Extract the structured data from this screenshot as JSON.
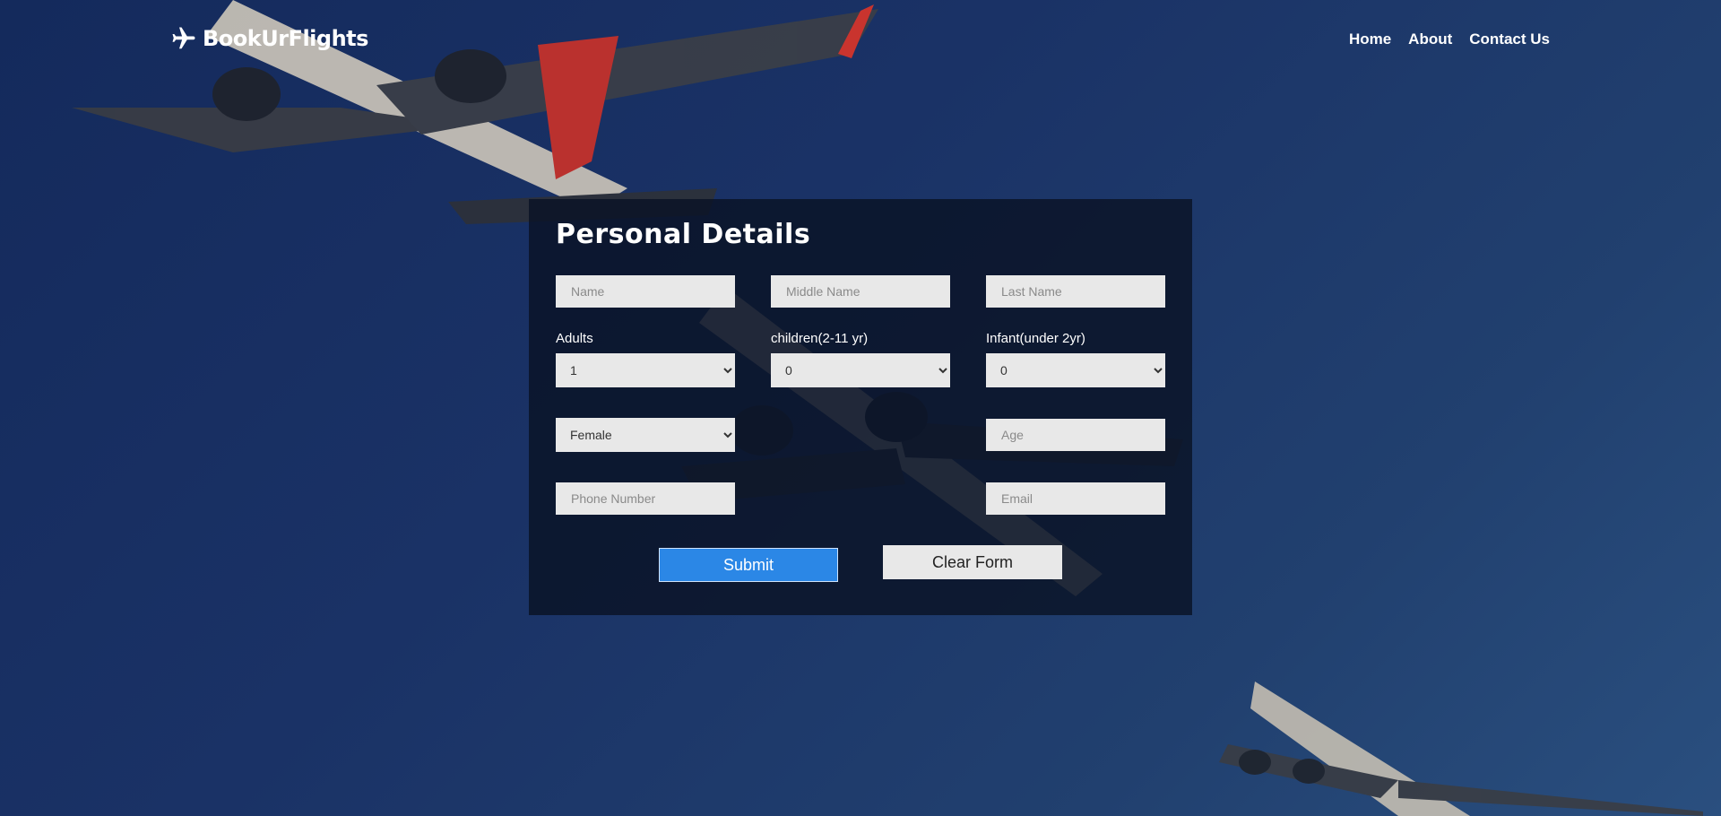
{
  "brand": {
    "name": "BookUrFlights",
    "icon": "airplane-icon"
  },
  "nav": {
    "items": [
      "Home",
      "About",
      "Contact Us"
    ]
  },
  "form": {
    "title": "Personal Details",
    "name_placeholder": "Name",
    "middle_name_placeholder": "Middle Name",
    "last_name_placeholder": "Last Name",
    "adults_label": "Adults",
    "adults_value": "1",
    "children_label": "children(2-11 yr)",
    "children_value": "0",
    "infant_label": "Infant(under 2yr)",
    "infant_value": "0",
    "gender_value": "Female",
    "age_placeholder": "Age",
    "phone_placeholder": "Phone Number",
    "email_placeholder": "Email",
    "submit_label": "Submit",
    "clear_label": "Clear Form"
  },
  "colors": {
    "background": "#1a3266",
    "card": "#0a1224",
    "submit": "#2b87e6",
    "field": "#e8e8e8"
  }
}
